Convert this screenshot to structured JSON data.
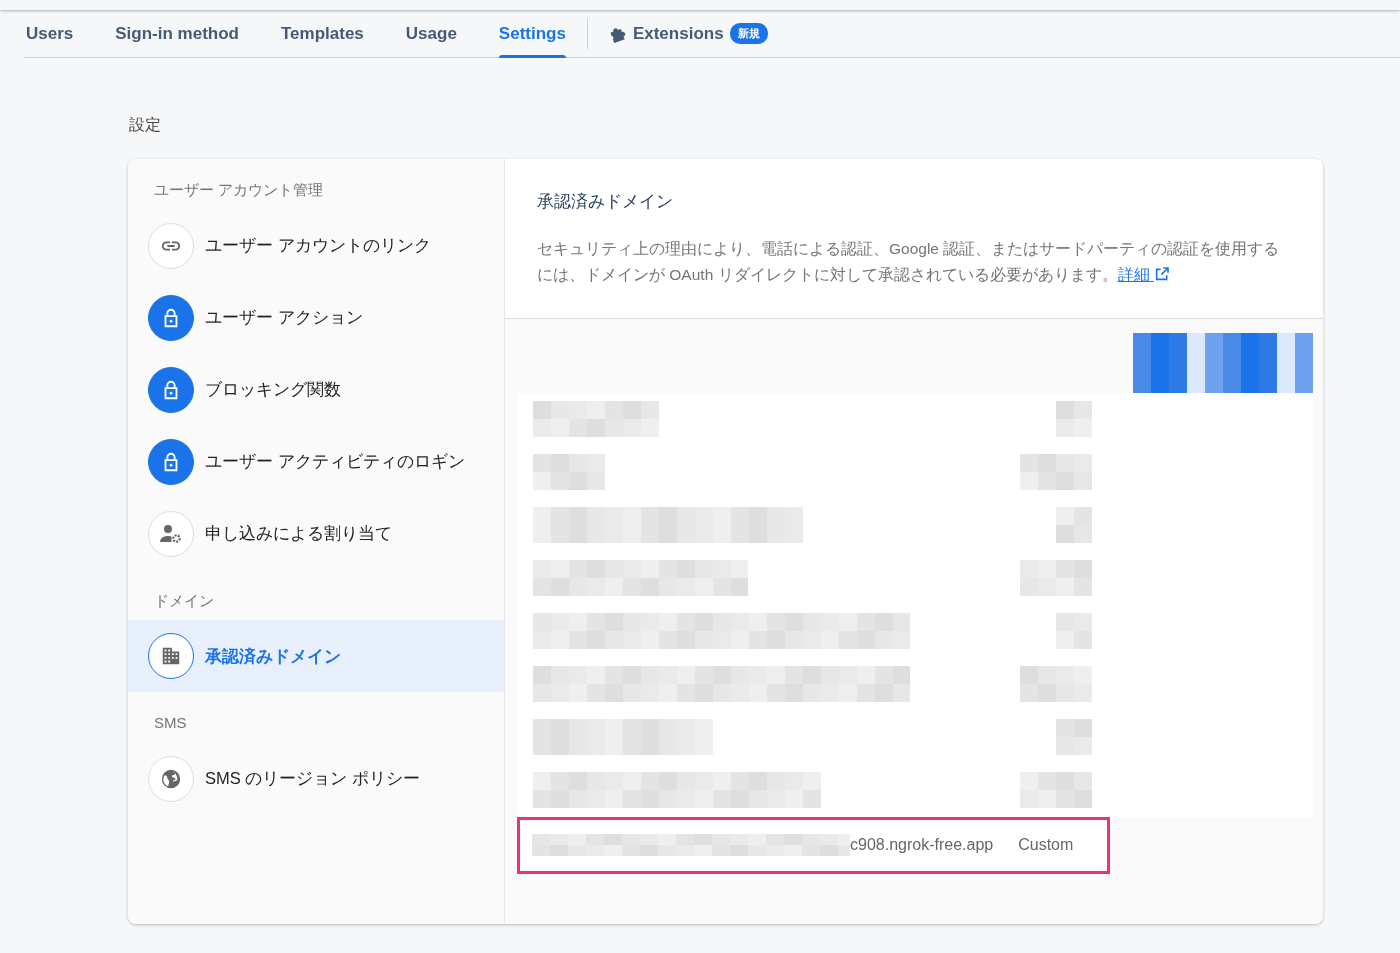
{
  "tabs": [
    {
      "label": "Users",
      "selected": false,
      "kind": "plain"
    },
    {
      "label": "Sign-in method",
      "selected": false,
      "kind": "plain"
    },
    {
      "label": "Templates",
      "selected": false,
      "kind": "plain"
    },
    {
      "label": "Usage",
      "selected": false,
      "kind": "plain"
    },
    {
      "label": "Settings",
      "selected": true,
      "kind": "plain"
    },
    {
      "label": "Extensions",
      "selected": false,
      "kind": "extension",
      "badge": "新規"
    }
  ],
  "page_title": "設定",
  "sidebar": [
    {
      "heading": "ユーザー アカウント管理",
      "items": [
        {
          "label": "ユーザー アカウントのリンク",
          "kind": "link",
          "selected": false
        },
        {
          "label": "ユーザー アクション",
          "kind": "lock",
          "selected": false
        },
        {
          "label": "ブロッキング関数",
          "kind": "lock",
          "selected": false
        },
        {
          "label": "ユーザー アクティビティのロギン",
          "kind": "lock",
          "selected": false
        },
        {
          "label": "申し込みによる割り当て",
          "kind": "person",
          "selected": false
        }
      ]
    },
    {
      "heading": "ドメイン",
      "items": [
        {
          "label": "承認済みドメイン",
          "kind": "building",
          "selected": true
        }
      ]
    },
    {
      "heading": "SMS",
      "items": [
        {
          "label": "SMS のリージョン ポリシー",
          "kind": "globe",
          "selected": false
        }
      ]
    }
  ],
  "detail": {
    "title": "承認済みドメイン",
    "description": "セキュリティ上の理由により、電話による認証、Google 認証、またはサードパーティの認証を使用するには、ドメインが OAuth リダイレクトに対して承認されている必要があります。",
    "link": "詳細"
  },
  "domains": [
    {
      "kind": "redacted"
    },
    {
      "kind": "redacted"
    },
    {
      "kind": "redacted"
    },
    {
      "kind": "redacted"
    },
    {
      "kind": "redacted"
    },
    {
      "kind": "redacted"
    },
    {
      "kind": "redacted"
    },
    {
      "kind": "redacted"
    },
    {
      "kind": "visible",
      "domain": "c908.ngrok-free.app",
      "type": "Custom",
      "highlighted": true
    }
  ]
}
